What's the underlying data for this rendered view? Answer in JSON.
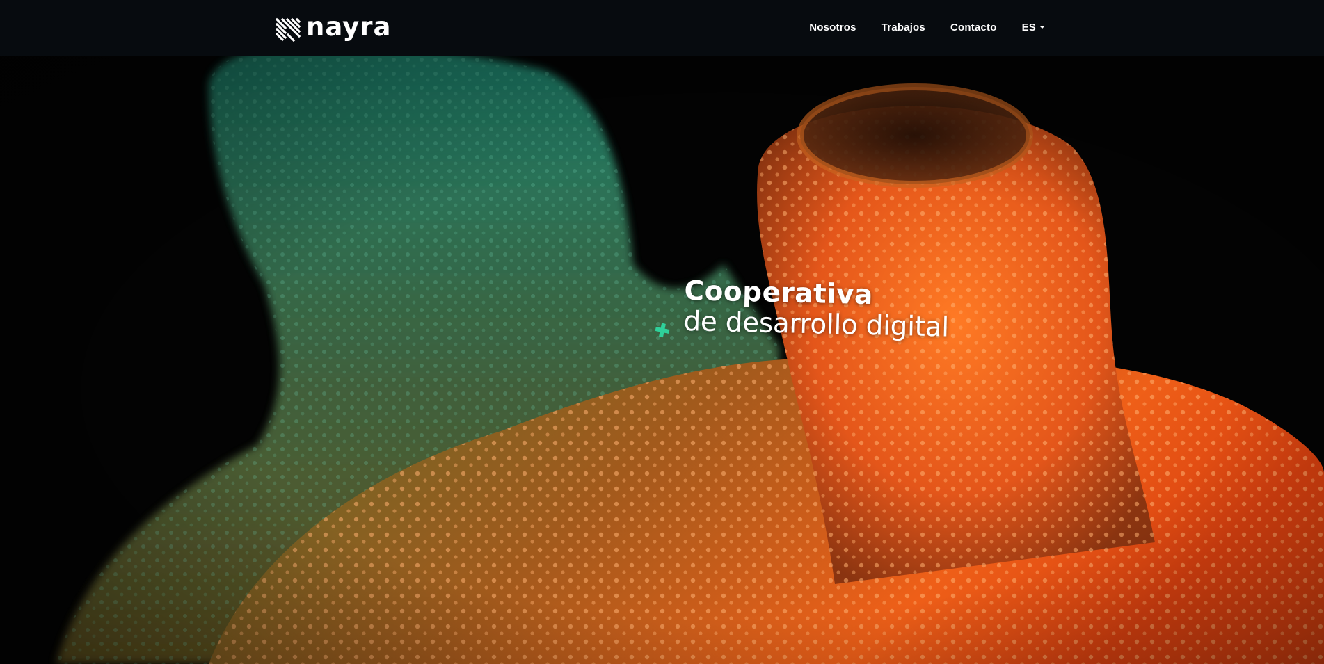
{
  "brand": {
    "name": "nayra",
    "icon": "nayra-logo-icon"
  },
  "nav": {
    "items": [
      {
        "label": "Nosotros"
      },
      {
        "label": "Trabajos"
      },
      {
        "label": "Contacto"
      }
    ],
    "language": {
      "label": "ES",
      "icon": "caret-down-icon"
    }
  },
  "hero": {
    "title": "Cooperativa",
    "subtitle": "de desarrollo digital",
    "icon": "plus-icon"
  },
  "colors": {
    "navbar_bg": "#070b0f",
    "accent": "#2fd09a",
    "teal": "#2a9a7e",
    "orange": "#ff6a1c",
    "deep_orange": "#d8400d"
  }
}
